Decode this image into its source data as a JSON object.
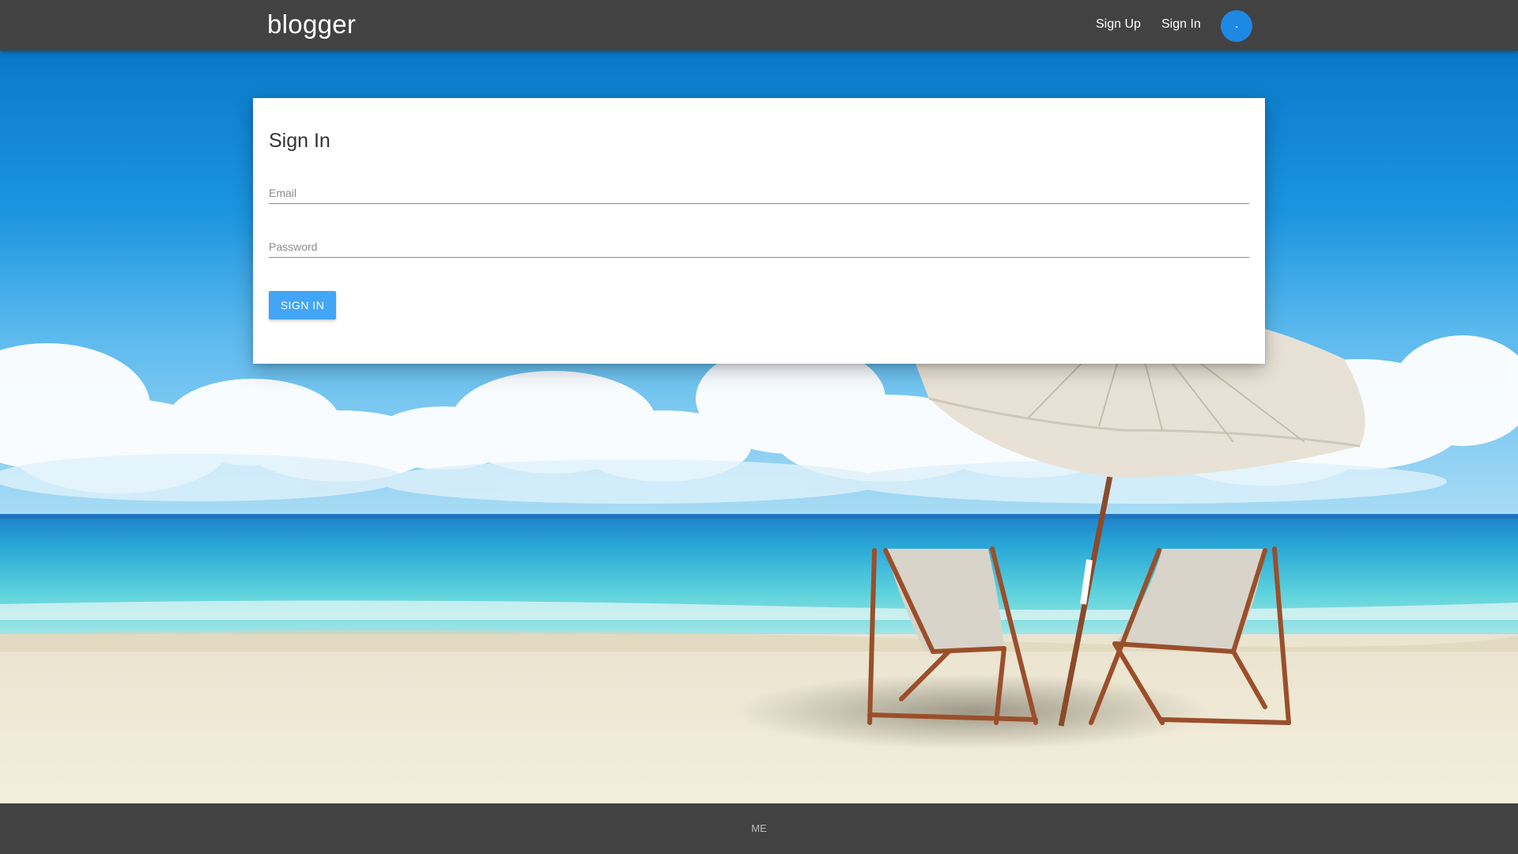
{
  "navbar": {
    "brand": "blogger",
    "links": {
      "sign_up": "Sign Up",
      "sign_in": "Sign In"
    },
    "avatar_text": "."
  },
  "signin_card": {
    "title": "Sign In",
    "email": {
      "placeholder": "Email",
      "value": ""
    },
    "password": {
      "placeholder": "Password",
      "value": ""
    },
    "submit_label": "SIGN IN"
  },
  "footer": {
    "text": "ME"
  },
  "icons": {
    "background": "beach-scene-image"
  },
  "colors": {
    "navbar": "#424242",
    "accent_button": "#42a5f5",
    "avatar": "#1e88e5",
    "footer": "#424242"
  }
}
